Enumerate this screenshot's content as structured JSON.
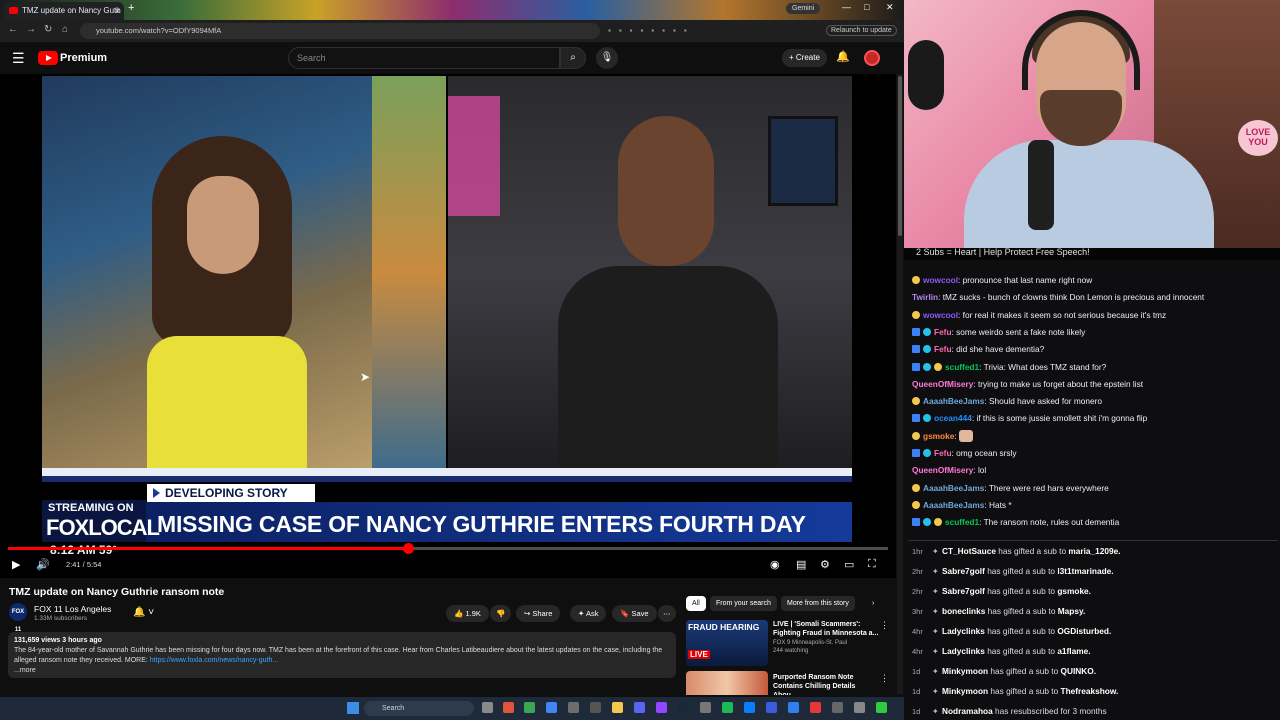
{
  "browser": {
    "tab_title": "TMZ update on Nancy Guth",
    "tab_close": "×",
    "new_tab": "+",
    "gemini_label": "Gemini",
    "url": "youtube.com/watch?v=ODfY9094MfA",
    "relaunch_label": "Relaunch to update",
    "window_controls": [
      "—",
      "□",
      "✕"
    ]
  },
  "youtube": {
    "logo_text": "Premium",
    "search_placeholder": "Search",
    "create_label": "+ Create"
  },
  "video": {
    "headline": "MISSING CASE OF NANCY GUTHRIE ENTERS FOURTH DAY",
    "developing": "DEVELOPING STORY",
    "streaming_on": "STREAMING ON",
    "fox_local": "FOXLOCAL",
    "clock_overlay": "8:12 AM  59°",
    "time_display": "2:41 / 5:54",
    "progress_fraction": 0.455
  },
  "details": {
    "title": "TMZ update on Nancy Guthrie ransom note",
    "channel_name": "FOX 11 Los Angeles",
    "channel_avatar": "FOX 11",
    "subscribers": "1.33M subscribers",
    "likes": "1.9K",
    "share_label": "Share",
    "ask_label": "Ask",
    "save_label": "Save",
    "more_label": "⋯",
    "description_meta": "131,659 views  3 hours ago",
    "description_text": "The 84-year-old mother of Savannah Guthrie has been missing for four days now. TMZ has been at the forefront of this case. Hear from Charles Latibeaudiere about the latest updates on the case, including the alleged ransom note they received. MORE: ",
    "description_link": "https://www.foxla.com/news/nancy-guth...",
    "description_more": "...more"
  },
  "recommendations": {
    "chips": [
      "All",
      "From your search",
      "More from this story"
    ],
    "items": [
      {
        "title": "LIVE | 'Somali Scammers': Fighting Fraud in Minnesota a...",
        "channel": "FOX 9 Minneapolis-St. Paul",
        "meta": "244 watching",
        "thumb_text": "FRAUD HEARING",
        "thumb_badge": "LIVE"
      },
      {
        "title": "Purported Ransom Note Contains Chilling Details Abou...",
        "channel": "",
        "meta": "",
        "thumb_text": "",
        "thumb_badge": ""
      }
    ]
  },
  "taskbar": {
    "search_label": "Search"
  },
  "webcam": {
    "love_sign": "LOVE YOU"
  },
  "chat": {
    "banner": "2 Subs = Heart | Help Protect Free Speech!",
    "messages": [
      {
        "user": "wowcool",
        "text": "pronounce that last name right now",
        "color": "#8a5cf6",
        "badges": 1
      },
      {
        "user": "Twirlin",
        "text": "tMZ sucks - bunch of clowns think Don Lemon is precious and innocent",
        "color": "#b784f5",
        "badges": 0
      },
      {
        "user": "wowcool",
        "text": "for real it makes it seem so not serious because it's tmz",
        "color": "#8a5cf6",
        "badges": 1
      },
      {
        "user": "Fefu",
        "text": "some weirdo sent a fake note likely",
        "color": "#ff69b4",
        "badges": 2
      },
      {
        "user": "Fefu",
        "text": "did she have dementia?",
        "color": "#ff69b4",
        "badges": 2
      },
      {
        "user": "scuffed1",
        "text": "Trivia: What does TMZ stand for?",
        "color": "#00c853",
        "badges": 3
      },
      {
        "user": "QueenOfMisery",
        "text": "trying to make us forget about the epstein list",
        "color": "#ff7ad9",
        "badges": 0
      },
      {
        "user": "AaaahBeeJams",
        "text": "Should have asked for monero",
        "color": "#6fa8dc",
        "badges": 1
      },
      {
        "user": "ocean444",
        "text": "if this is some jussie smollett shit i'm gonna flip",
        "color": "#1e90ff",
        "badges": 2
      },
      {
        "user": "gsmoke",
        "text": "",
        "color": "#ff8a3d",
        "badges": 1,
        "emote": true
      },
      {
        "user": "Fefu",
        "text": "omg ocean srsly",
        "color": "#ff69b4",
        "badges": 2
      },
      {
        "user": "QueenOfMisery",
        "text": "lol",
        "color": "#ff7ad9",
        "badges": 0
      },
      {
        "user": "AaaahBeeJams",
        "text": "There were red hars everywhere",
        "color": "#6fa8dc",
        "badges": 1
      },
      {
        "user": "AaaahBeeJams",
        "text": "Hats *",
        "color": "#6fa8dc",
        "badges": 1
      },
      {
        "user": "scuffed1",
        "text": "The ransom note, rules out dementia",
        "color": "#00c853",
        "badges": 3
      }
    ],
    "events": [
      {
        "age": "1hr",
        "name": "CT_HotSauce",
        "action": "has gifted a sub to",
        "target": "maria_1209e."
      },
      {
        "age": "2hr",
        "name": "Sabre7golf",
        "action": "has gifted a sub to",
        "target": "l3t1tmarinade."
      },
      {
        "age": "2hr",
        "name": "Sabre7golf",
        "action": "has gifted a sub to",
        "target": "gsmoke."
      },
      {
        "age": "3hr",
        "name": "boneclinks",
        "action": "has gifted a sub to",
        "target": "Mapsy."
      },
      {
        "age": "4hr",
        "name": "Ladyclinks",
        "action": "has gifted a sub to",
        "target": "OGDisturbed."
      },
      {
        "age": "4hr",
        "name": "Ladyclinks",
        "action": "has gifted a sub to",
        "target": "a1flame."
      },
      {
        "age": "1d",
        "name": "Minkymoon",
        "action": "has gifted a sub to",
        "target": "QUINKO."
      },
      {
        "age": "1d",
        "name": "Minkymoon",
        "action": "has gifted a sub to",
        "target": "Thefreakshow."
      },
      {
        "age": "1d",
        "name": "Nodramahoa",
        "action": "has resubscribed for 3 months",
        "target": ""
      }
    ]
  },
  "colors": {
    "youtube_red": "#ff0000",
    "fox_navy": "#0a1d5a",
    "chat_bg": "#0e0e10"
  }
}
